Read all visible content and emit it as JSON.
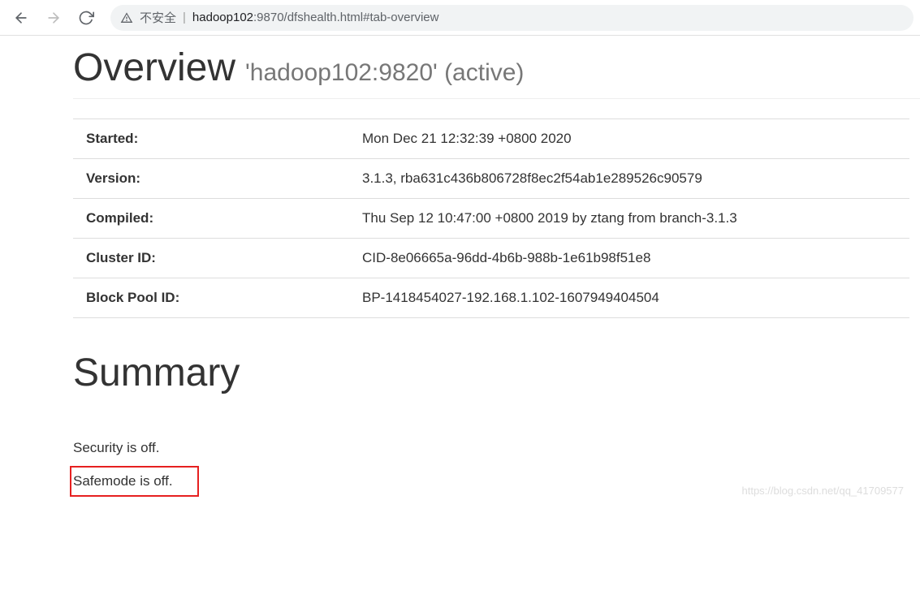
{
  "browser": {
    "not_secure_label": "不安全",
    "url_host": "hadoop102",
    "url_port_path": ":9870/dfshealth.html#tab-overview"
  },
  "overview": {
    "title_main": "Overview",
    "title_sub": "'hadoop102:9820' (active)"
  },
  "info_rows": [
    {
      "label": "Started:",
      "value": "Mon Dec 21 12:32:39 +0800 2020"
    },
    {
      "label": "Version:",
      "value": "3.1.3, rba631c436b806728f8ec2f54ab1e289526c90579"
    },
    {
      "label": "Compiled:",
      "value": "Thu Sep 12 10:47:00 +0800 2019 by ztang from branch-3.1.3"
    },
    {
      "label": "Cluster ID:",
      "value": "CID-8e06665a-96dd-4b6b-988b-1e61b98f51e8"
    },
    {
      "label": "Block Pool ID:",
      "value": "BP-1418454027-192.168.1.102-1607949404504"
    }
  ],
  "summary": {
    "title": "Summary",
    "security_text": "Security is off.",
    "safemode_text": "Safemode is off."
  },
  "watermark": "https://blog.csdn.net/qq_41709577"
}
